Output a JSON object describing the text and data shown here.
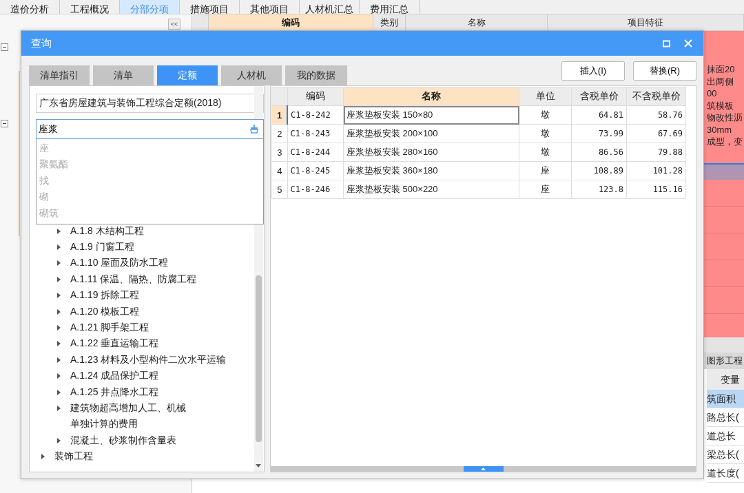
{
  "app": {
    "tabs": [
      {
        "label": "造价分析",
        "selected": false
      },
      {
        "label": "工程概况",
        "selected": false
      },
      {
        "label": "分部分项",
        "selected": true
      },
      {
        "label": "措施项目",
        "selected": false
      },
      {
        "label": "其他项目",
        "selected": false
      },
      {
        "label": "人材机汇总",
        "selected": false
      },
      {
        "label": "费用汇总",
        "selected": false
      }
    ],
    "collapse_button": "<<",
    "grid_columns": [
      "编码",
      "类别",
      "名称",
      "项目特征"
    ],
    "feature_text": [
      "抹面20",
      "出两侧",
      "00",
      "筑模板",
      "物改性沥",
      "30mm",
      "成型，变"
    ],
    "lower_panel": {
      "title": "图形工程",
      "column": "变量",
      "rows": [
        {
          "label": "筑面积",
          "selected": true
        },
        {
          "label": "路总长(",
          "selected": false
        },
        {
          "label": "道总长",
          "selected": false
        },
        {
          "label": "梁总长(",
          "selected": false
        },
        {
          "label": "道长度(",
          "selected": false
        }
      ]
    }
  },
  "dialog": {
    "title": "查询",
    "tabs": [
      {
        "label": "清单指引",
        "selected": false
      },
      {
        "label": "清单",
        "selected": false
      },
      {
        "label": "定额",
        "selected": true
      },
      {
        "label": "人材机",
        "selected": false
      },
      {
        "label": "我的数据",
        "selected": false
      }
    ],
    "buttons": [
      "插入(I)",
      "替换(R)"
    ],
    "library": "广东省房屋建筑与装饰工程综合定额(2018)",
    "search": {
      "value": "座浆"
    },
    "suggestions": [
      "座",
      "聚氨酯",
      "找",
      "砌",
      "砌筑"
    ],
    "tree": [
      {
        "children": [
          {
            "label": "A.1.8 木结构工程",
            "has_children": true
          },
          {
            "label": "A.1.9 门窗工程",
            "has_children": true
          },
          {
            "label": "A.1.10 屋面及防水工程",
            "has_children": true
          },
          {
            "label": "A.1.11 保温、隔热、防腐工程",
            "has_children": true
          },
          {
            "label": "A.1.19 拆除工程",
            "has_children": true
          },
          {
            "label": "A.1.20 模板工程",
            "has_children": true
          },
          {
            "label": "A.1.21 脚手架工程",
            "has_children": true
          },
          {
            "label": "A.1.22 垂直运输工程",
            "has_children": true
          },
          {
            "label": "A.1.23 材料及小型构件二次水平运输",
            "has_children": true
          },
          {
            "label": "A.1.24 成品保护工程",
            "has_children": true
          },
          {
            "label": "A.1.25 井点降水工程",
            "has_children": true
          },
          {
            "label": "建筑物超高增加人工、机械",
            "has_children": true
          },
          {
            "label": "单独计算的费用",
            "has_children": false
          },
          {
            "label": "混凝土、砂浆制作含量表",
            "has_children": true
          }
        ]
      },
      {
        "label": "装饰工程",
        "has_children": true
      }
    ],
    "table": {
      "columns": [
        "编码",
        "名称",
        "单位",
        "含税单价",
        "不含税单价"
      ],
      "rows": [
        {
          "num": "1",
          "code": "C1-8-242",
          "name": "座浆垫板安装 150×80",
          "unit": "墩",
          "price_tax": "64.81",
          "price": "58.76",
          "selected": true
        },
        {
          "num": "2",
          "code": "C1-8-243",
          "name": "座浆垫板安装 200×100",
          "unit": "墩",
          "price_tax": "73.99",
          "price": "67.69",
          "selected": false
        },
        {
          "num": "3",
          "code": "C1-8-244",
          "name": "座浆垫板安装 280×160",
          "unit": "墩",
          "price_tax": "86.56",
          "price": "79.88",
          "selected": false
        },
        {
          "num": "4",
          "code": "C1-8-245",
          "name": "座浆垫板安装 360×180",
          "unit": "座",
          "price_tax": "108.89",
          "price": "101.28",
          "selected": false
        },
        {
          "num": "5",
          "code": "C1-8-246",
          "name": "座浆垫板安装 500×220",
          "unit": "座",
          "price_tax": "123.8",
          "price": "115.16",
          "selected": false
        }
      ]
    }
  }
}
